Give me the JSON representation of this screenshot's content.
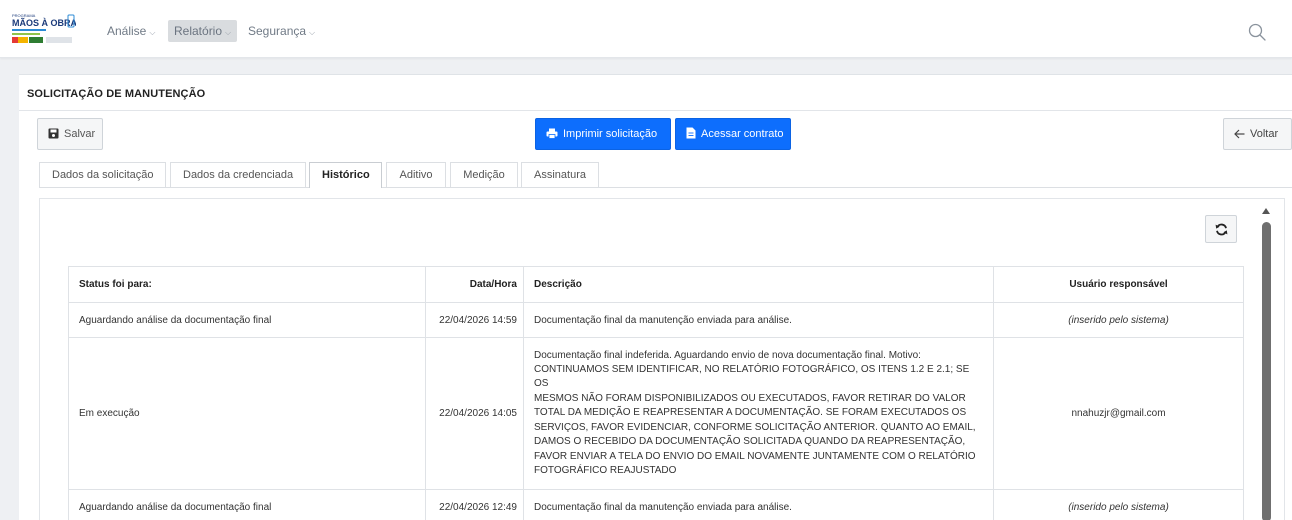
{
  "navbar": {
    "logo_text": "MÃOS À OBRA!",
    "menu": [
      {
        "label": "Análise",
        "active": false
      },
      {
        "label": "Relatório",
        "active": true
      },
      {
        "label": "Segurança",
        "active": false
      }
    ],
    "search_icon": "search-icon"
  },
  "page": {
    "title": "SOLICITAÇÃO DE MANUTENÇÃO"
  },
  "toolbar": {
    "save_label": "Salvar",
    "print_label": "Imprimir solicitação",
    "contract_label": "Acessar contrato",
    "back_label": "Voltar"
  },
  "tabs": [
    {
      "label": "Dados da solicitação",
      "active": false
    },
    {
      "label": "Dados da credenciada",
      "active": false
    },
    {
      "label": "Histórico",
      "active": true
    },
    {
      "label": "Aditivo",
      "active": false
    },
    {
      "label": "Medição",
      "active": false
    },
    {
      "label": "Assinatura",
      "active": false
    }
  ],
  "history": {
    "columns": [
      "Status foi para:",
      "Data/Hora",
      "Descrição",
      "Usuário responsável"
    ],
    "rows": [
      {
        "status": "Aguardando análise da documentação final",
        "datetime": "22/04/2026 14:59",
        "description": "Documentação final da manutenção enviada para análise.",
        "user": "(inserido pelo sistema)"
      },
      {
        "status": "Em execução",
        "datetime": "22/04/2026 14:05",
        "description_lines": [
          "Documentação final indeferida. Aguardando envio de nova documentação final. Motivo:",
          "CONTINUAMOS SEM IDENTIFICAR, NO RELATÓRIO FOTOGRÁFICO, OS ITENS 1.2 E 2.1; SE OS",
          "MESMOS NÃO FORAM DISPONIBILIZADOS OU EXECUTADOS, FAVOR RETIRAR DO VALOR",
          "TOTAL DA MEDIÇÃO E REAPRESENTAR A DOCUMENTAÇÃO. SE FORAM EXECUTADOS OS",
          "SERVIÇOS, FAVOR EVIDENCIAR, CONFORME SOLICITAÇÃO ANTERIOR. QUANTO AO EMAIL,",
          "DAMOS O RECEBIDO DA DOCUMENTAÇÃO SOLICITADA QUANDO DA REAPRESENTAÇÃO,",
          "FAVOR ENVIAR A TELA DO ENVIO DO EMAIL NOVAMENTE JUNTAMENTE COM O RELATÓRIO",
          "FOTOGRÁFICO REAJUSTADO"
        ],
        "user": "nnahuzjr@gmail.com"
      },
      {
        "status": "Aguardando análise da documentação final",
        "datetime": "22/04/2026 12:49",
        "description": "Documentação final da manutenção enviada para análise.",
        "user": "(inserido pelo sistema)"
      }
    ]
  },
  "colors": {
    "primary": "#0d6efd",
    "navbar_active": "#d9dcdf",
    "scrollbar": "#6f6f6f"
  }
}
